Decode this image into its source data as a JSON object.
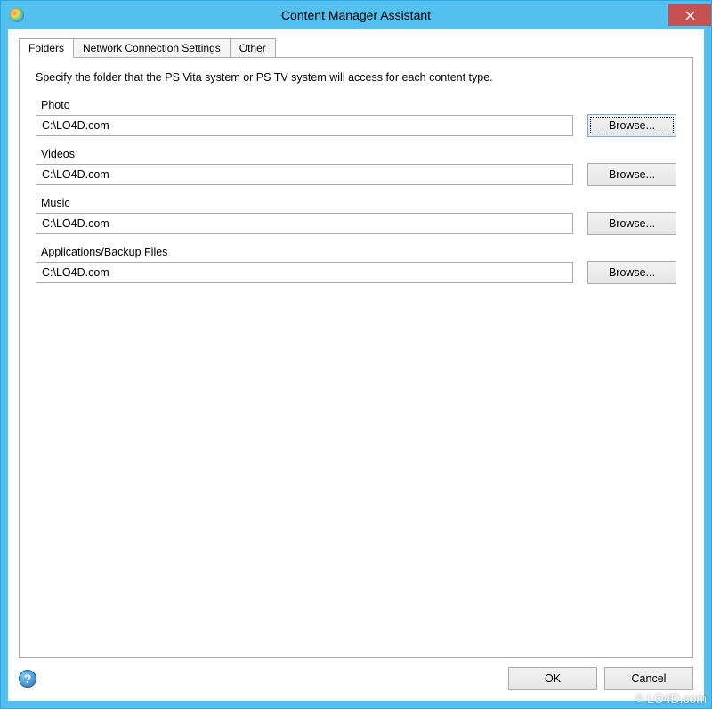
{
  "window": {
    "title": "Content Manager Assistant"
  },
  "tabs": [
    {
      "label": "Folders",
      "active": true
    },
    {
      "label": "Network Connection Settings",
      "active": false
    },
    {
      "label": "Other",
      "active": false
    }
  ],
  "description": "Specify the folder that the PS Vita system or PS TV system will access for each content type.",
  "folders": [
    {
      "label": "Photo",
      "path": "C:\\LO4D.com",
      "browse": "Browse...",
      "focused": true
    },
    {
      "label": "Videos",
      "path": "C:\\LO4D.com",
      "browse": "Browse...",
      "focused": false
    },
    {
      "label": "Music",
      "path": "C:\\LO4D.com",
      "browse": "Browse...",
      "focused": false
    },
    {
      "label": "Applications/Backup Files",
      "path": "C:\\LO4D.com",
      "browse": "Browse...",
      "focused": false
    }
  ],
  "buttons": {
    "ok": "OK",
    "cancel": "Cancel"
  },
  "help": "?",
  "watermark": "LO4D.com",
  "copyright": "©"
}
